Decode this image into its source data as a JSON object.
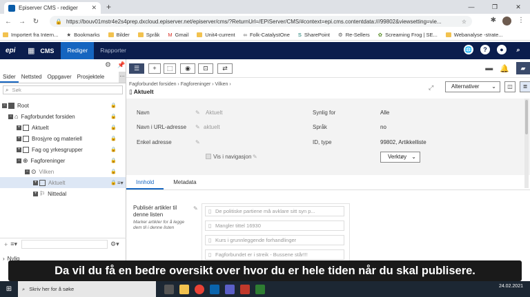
{
  "browser": {
    "tab_title": "Episerver CMS - rediger",
    "url": "https://bouv01mstr4e2s4prep.dxcloud.episerver.net/episerver/cms/?ReturnUrl=/EPiServer/CMS/#context=epi.cms.contentdata:///99802&viewsetting=vie...",
    "window_controls": [
      "—",
      "❐",
      "✕"
    ],
    "bookmarks": [
      "Importert fra Intern...",
      "Bookmarks",
      "Bilder",
      "Språk",
      "Gmail",
      "Unit4-current",
      "Folk-CatalystOne",
      "SharePoint",
      "Re-Sellers",
      "Screaming Frog | SE...",
      "Webanalyse -strate..."
    ]
  },
  "cms_nav": {
    "product": "CMS",
    "tabs": [
      "Rediger",
      "Rapporter"
    ],
    "active_tab": "Rediger",
    "accent": "#1565c0",
    "background": "#0b1d4d"
  },
  "left_pane": {
    "tabs": [
      "Sider",
      "Nettsted",
      "Oppgaver",
      "Prosjektele"
    ],
    "search_placeholder": "Søk",
    "tree": [
      {
        "label": "Root",
        "indent": 0
      },
      {
        "label": "Fagforbundet forsiden",
        "indent": 1
      },
      {
        "label": "Aktuelt",
        "indent": 2
      },
      {
        "label": "Brosjyre og materiell",
        "indent": 2
      },
      {
        "label": "Fag og yrkesgrupper",
        "indent": 2
      },
      {
        "label": "Fagforeninger",
        "indent": 2
      },
      {
        "label": "Vilken",
        "indent": 3
      },
      {
        "label": "Aktuelt",
        "indent": 4
      },
      {
        "label": "Nittedal",
        "indent": 4
      }
    ],
    "bottom_item": "Nylig"
  },
  "main": {
    "breadcrumb": "Fagforbundet forsiden  ›  Fagforeninger  ›  Vilken  ›",
    "page_title": "Aktuelt",
    "alternatives_label": "Alternativer",
    "properties": {
      "name_label": "Navn",
      "name_value": "Aktuelt",
      "url_label": "Navn i URL-adresse",
      "url_value": "aktuelt",
      "simple_label": "Enkel adresse",
      "nav_label": "Vis i navigasjon",
      "visible_label": "Synlig for",
      "visible_value": "Alle",
      "lang_label": "Språk",
      "lang_value": "no",
      "id_label": "ID, type",
      "id_value": "99802, Artikkelliste",
      "tools_label": "Verktøy"
    },
    "content_tabs": [
      "Innhold",
      "Metadata"
    ],
    "active_content_tab": "Innhold",
    "publish_label": "Publisér artikler til denne listen",
    "publish_help": "Marker artikler for å legge dem til i denne listen",
    "articles": [
      "De politiske partiene må avklare sitt syn p...",
      "Mangler tittel 16930",
      "Kurs i grunnleggende forhandlinger",
      "Fagforbundet er i streik - Bussene står!!!"
    ]
  },
  "subtitle": "Da vil du få en bedre oversikt over hvor du er hele tiden når du skal publisere.",
  "taskbar": {
    "search_placeholder": "Skriv her for å søke",
    "date": "24.02.2021"
  }
}
